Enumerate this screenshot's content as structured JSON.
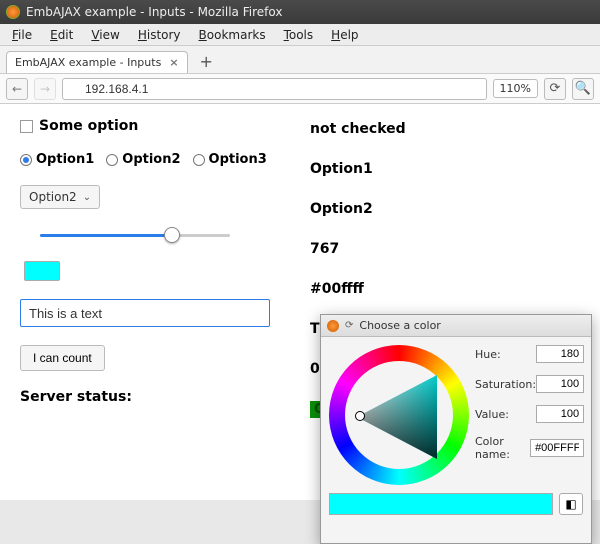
{
  "window": {
    "title": "EmbAJAX example - Inputs - Mozilla Firefox"
  },
  "menubar": [
    "File",
    "Edit",
    "View",
    "History",
    "Bookmarks",
    "Tools",
    "Help"
  ],
  "tab": {
    "label": "EmbAJAX example - Inputs"
  },
  "url": {
    "value": "192.168.4.1",
    "zoom": "110%"
  },
  "form": {
    "checkbox_label": "Some option",
    "checkbox_output": "not checked",
    "radios": [
      "Option1",
      "Option2",
      "Option3"
    ],
    "radio_selected": "Option1",
    "select_value": "Option2",
    "select_output": "Option2",
    "slider_output": "767",
    "color_output": "#00ffff",
    "text_value": "This is a text",
    "text_output": "This is",
    "button_label": "I can count",
    "button_output": "0",
    "server_label": "Server status:",
    "server_status": "OK"
  },
  "colorpicker": {
    "title": "Choose a color",
    "hue_label": "Hue:",
    "hue": "180",
    "sat_label": "Saturation:",
    "sat": "100",
    "val_label": "Value:",
    "val": "100",
    "name_label": "Color name:",
    "name": "#00FFFF"
  }
}
